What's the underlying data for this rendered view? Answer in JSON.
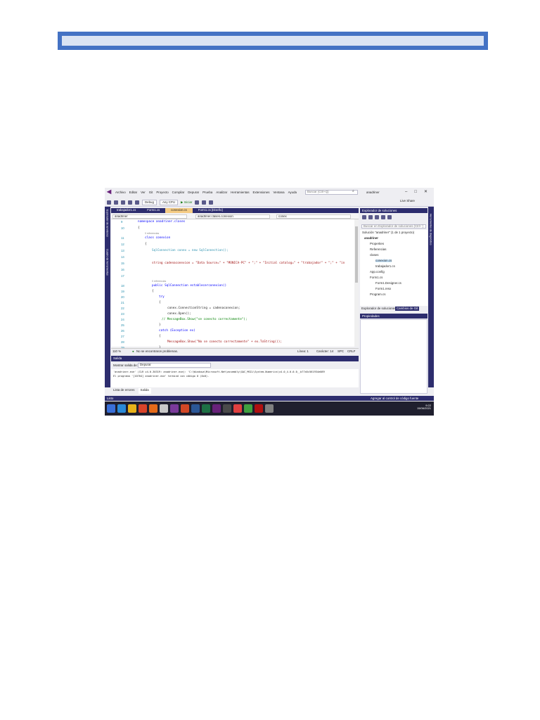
{
  "page": {
    "background": "#ffffff"
  },
  "banner": {
    "border_color": "#4472c4",
    "fill_color": "#dae3f3"
  },
  "vs": {
    "menu": [
      "Archivo",
      "Editar",
      "Ver",
      "Git",
      "Proyecto",
      "Compilar",
      "Depurar",
      "Prueba",
      "Analizar",
      "Herramientas",
      "Extensiones",
      "Ventana",
      "Ayuda"
    ],
    "search_placeholder": "Buscar (Ctrl+Q)",
    "user": "anadriner",
    "toolbar": {
      "config": "Debug",
      "platform": "Any CPU",
      "start": "Iniciar",
      "live_share": "Live Share"
    },
    "left_strip": [
      "Explorador de servidores",
      "Cuadro de herramientas"
    ],
    "right_strip": "Herramientas de diagnóstico",
    "tabs": [
      "trabajador1.cs",
      "Form1.cs",
      "conexion.cs",
      "Form1.cs [Diseño]"
    ],
    "nav": {
      "project": "anadriner",
      "class": "anadriner.clases.conexion",
      "member": "conex"
    },
    "line_numbers": [
      "9",
      "10",
      "11",
      "12",
      "13",
      "14",
      "15",
      "16",
      "17",
      "18",
      "19",
      "20",
      "21",
      "22",
      "23",
      "24",
      "25",
      "26",
      "27",
      "28",
      "29"
    ],
    "code": {
      "l9": "namespace anadriner.clases",
      "l10": "{",
      "ref1": "0 referencias",
      "l11": "class conexion",
      "l12": "{",
      "l13": "SqlConnection conex = new SqlConnection();",
      "l15": "string cadenaconexion = \"Data Source=\" + \"MONICA-PC\" + \";\" + \"Initial catalog=\" + \"trabajador\" + \";\" + \"in",
      "ref2": "0 referencias",
      "l18": "public SqlConnection establecerconexion()",
      "l19": "{",
      "l20": "try",
      "l21": "{",
      "l22": "conex.ConnectionString = cadenaconexion;",
      "l23": "conex.Open();",
      "l24": "// MessageBox.Show(\"se conecto correctamente\");",
      "l25": "}",
      "l26": "catch (Exception ex)",
      "l27": "{",
      "l28": "MessageBox.Show(\"No se conecto correctamente\" + ex.ToString());",
      "l29": "}"
    },
    "editor_status": {
      "zoom": "110 %",
      "issues": "No se encontraron problemas.",
      "line": "Línea: 1",
      "char": "Carácter: 14",
      "mode": "SPC",
      "eol": "CRLF"
    },
    "output": {
      "title": "Salida",
      "show_from_label": "Mostrar salida de:",
      "show_from_value": "Depurar",
      "line1": "'anadriner.exe' (CLR v4.0.30319: anadriner.exe): 'C:\\Windows\\Microsoft.Net\\assembly\\GAC_MSIL\\System.Numerics\\v4.0_4.0.0.0__b77a5c561934e089",
      "line2": "El programa '[10704] anadriner.exe' terminó con código 0 (0x0)."
    },
    "bottom_tabs": [
      "Lista de errores",
      "Salida"
    ],
    "solution_explorer": {
      "title": "Explorador de soluciones",
      "search": "Buscar en Explorador de soluciones (Ctrl+`)",
      "tree": [
        "Solución \"anadriner\" (1 de 1 proyecto)",
        "anadriner",
        "Properties",
        "Referencias",
        "clases",
        "conexion.cs",
        "trabajador1.cs",
        "App.config",
        "Form1.cs",
        "Form1.Designer.cs",
        "Form1.resx",
        "Program.cs"
      ],
      "tabs": [
        "Explorador de soluciones",
        "Cambios de Git"
      ]
    },
    "properties_title": "Propiedades",
    "status": {
      "left": "Listo",
      "right": "Agregar al control de código fuente"
    },
    "clock": {
      "time": "9:22",
      "date": "15/06/2021"
    },
    "colors": {
      "chrome": "#2d2d6e",
      "active_tab": "#f5cc84",
      "keyword": "#0000ff",
      "type": "#2b91af",
      "string": "#a31515",
      "comment": "#008000",
      "taskbar": "#1f1f2e"
    }
  }
}
